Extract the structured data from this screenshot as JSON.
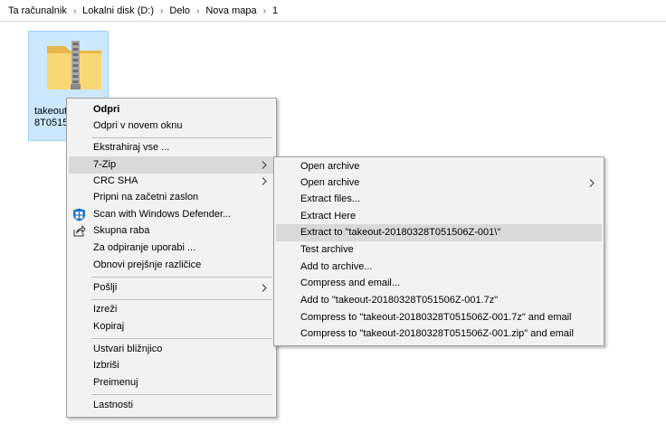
{
  "breadcrumb": [
    "Ta računalnik",
    "Lokalni disk (D:)",
    "Delo",
    "Nova mapa",
    "1"
  ],
  "file": {
    "name_line1": "takeout-",
    "name_line2": "8T05150"
  },
  "context_menu": {
    "open": "Odpri",
    "open_new_window": "Odpri v novem oknu",
    "extract_all": "Ekstrahiraj vse ...",
    "seven_zip": "7-Zip",
    "crc_sha": "CRC SHA",
    "pin_start": "Pripni na začetni zaslon",
    "scan_defender": "Scan with Windows Defender...",
    "share": "Skupna raba",
    "open_with": "Za odpiranje uporabi ...",
    "restore_versions": "Obnovi prejšnje različice",
    "send_to": "Pošlji",
    "cut": "Izreži",
    "copy": "Kopiraj",
    "create_shortcut": "Ustvari bližnjico",
    "delete": "Izbriši",
    "rename": "Preimenuj",
    "properties": "Lastnosti"
  },
  "seven_zip_menu": {
    "open_archive": "Open archive",
    "open_archive_sub": "Open archive",
    "extract_files": "Extract files...",
    "extract_here": "Extract Here",
    "extract_to": "Extract to \"takeout-20180328T051506Z-001\\\"",
    "test_archive": "Test archive",
    "add_to_archive": "Add to archive...",
    "compress_email": "Compress and email...",
    "add_to_7z": "Add to \"takeout-20180328T051506Z-001.7z\"",
    "compress_7z_email": "Compress to \"takeout-20180328T051506Z-001.7z\" and email",
    "compress_zip_email": "Compress to \"takeout-20180328T051506Z-001.zip\" and email"
  },
  "colors": {
    "selection_fill": "#cce8ff",
    "selection_border": "#99d1ff",
    "menu_bg": "#f2f2f2",
    "menu_highlight": "#d9d9d9",
    "folder_yellow": "#f8d775",
    "defender_blue": "#1e6fc5"
  }
}
